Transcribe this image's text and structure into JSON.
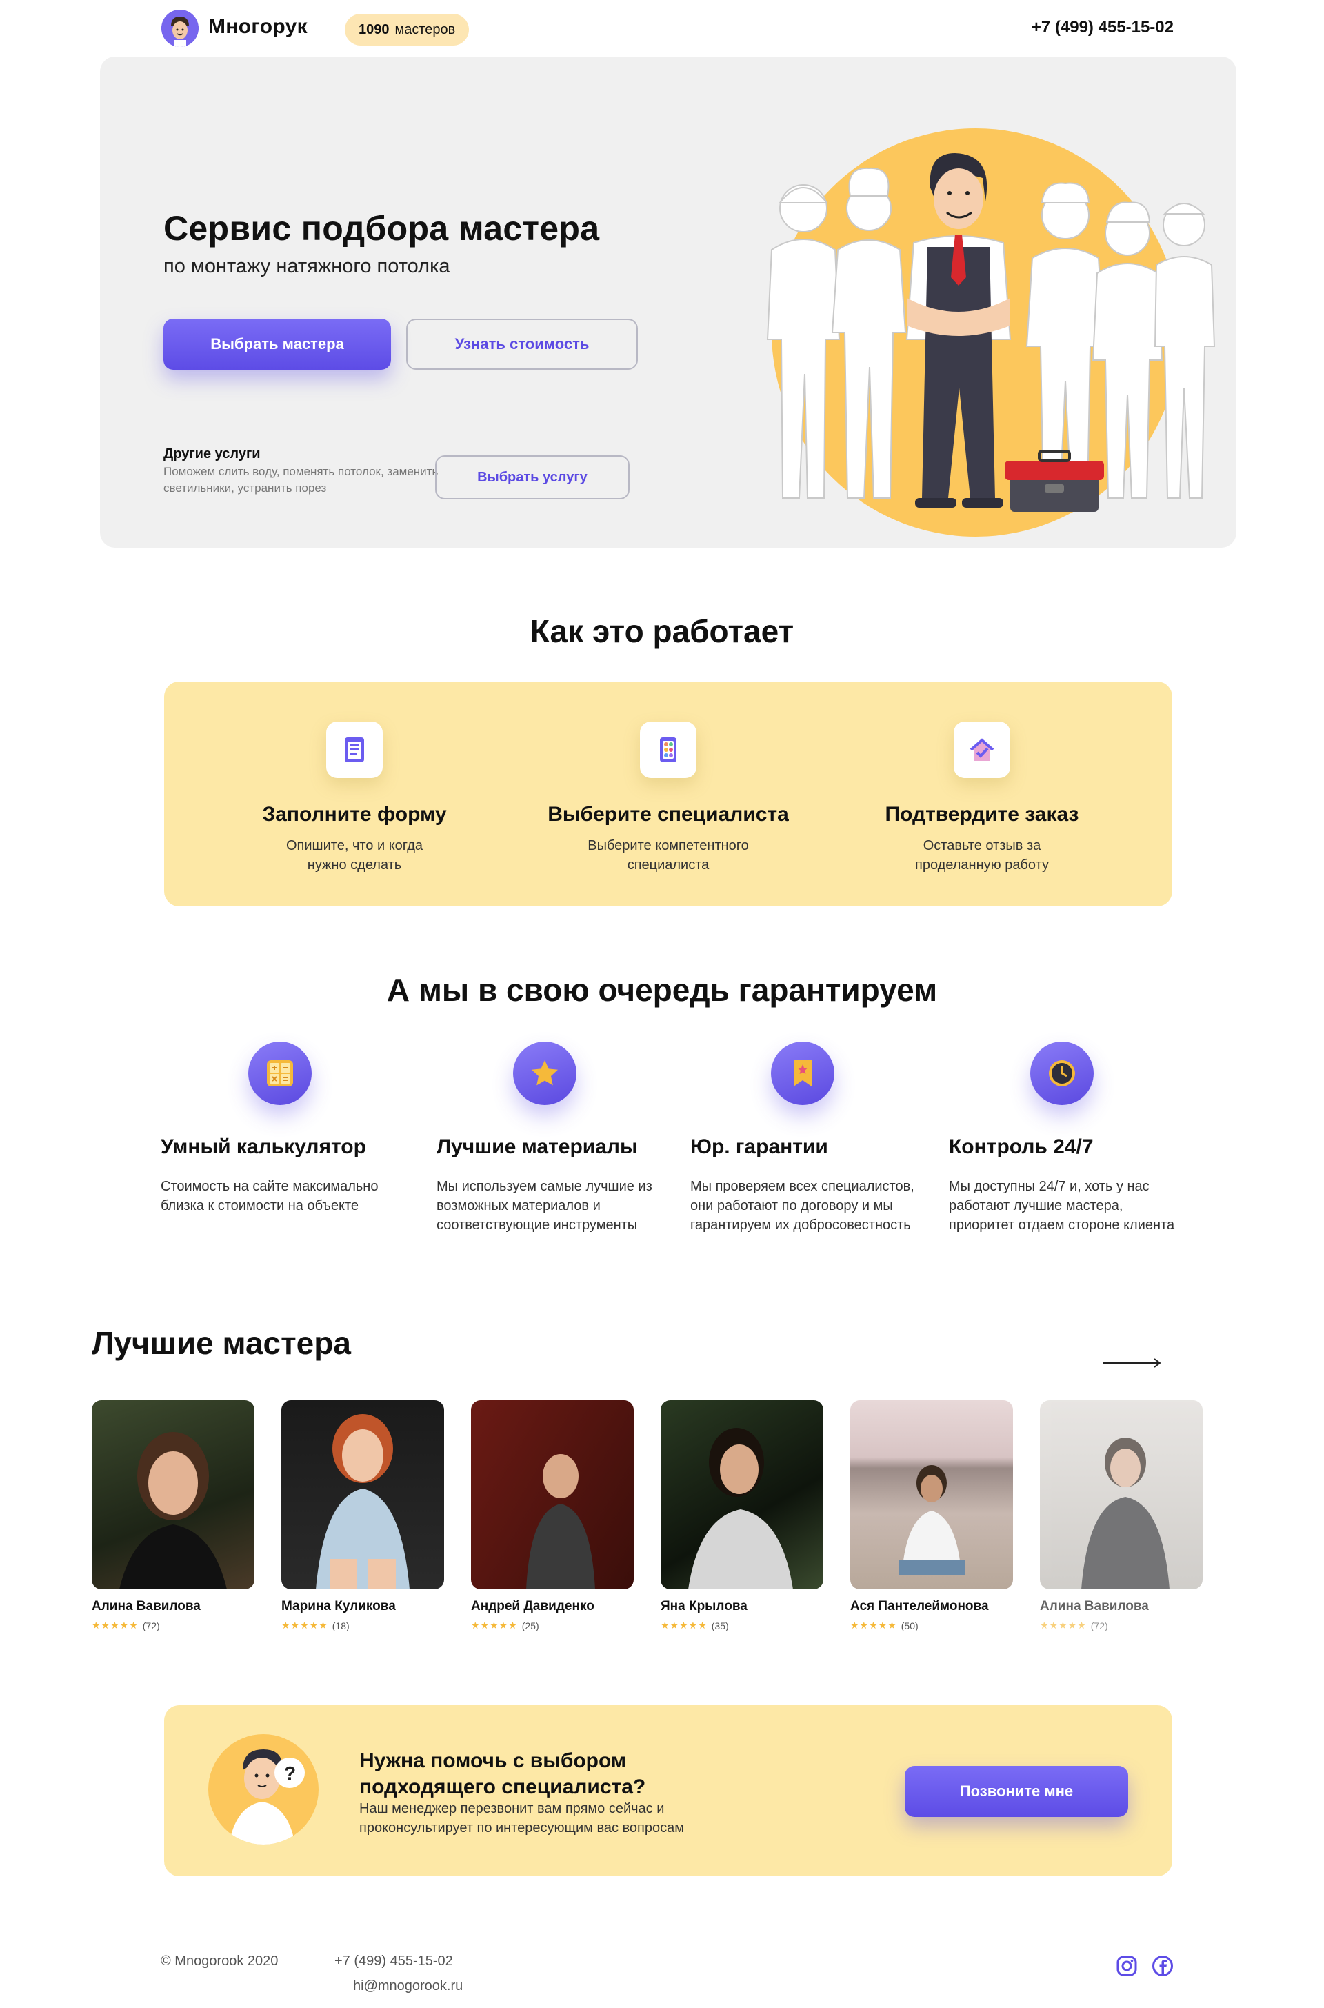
{
  "header": {
    "brand": "Многорук",
    "masters_count": "1090",
    "masters_label": "мастеров",
    "phone": "+7 (499) 455-15-02"
  },
  "hero": {
    "title": "Сервис подбора мастера",
    "subtitle": "по монтажу натяжного потолка",
    "primary_button": "Выбрать мастера",
    "secondary_button": "Узнать стоимость",
    "other_title": "Другие услуги",
    "other_desc": "Поможем слить воду, поменять потолок, заменить светильники, устранить порез",
    "other_button": "Выбрать услугу"
  },
  "how": {
    "title": "Как это работает",
    "steps": [
      {
        "icon": "form-icon",
        "title": "Заполните форму",
        "desc": "Опишите, что и когда нужно сделать"
      },
      {
        "icon": "specialist-icon",
        "title": "Выберите специалиста",
        "desc": "Выберите компетентного специалиста"
      },
      {
        "icon": "house-check-icon",
        "title": "Подтвердите заказ",
        "desc": "Оставьте отзыв за проделанную работу"
      }
    ]
  },
  "guarantee": {
    "title": "А мы в свою очередь гарантируем",
    "items": [
      {
        "icon": "calculator-icon",
        "title": "Умный калькулятор",
        "desc": "Стоимость на сайте максимально близка к стоимости на объекте"
      },
      {
        "icon": "star-icon",
        "title": "Лучшие материалы",
        "desc": "Мы используем самые лучшие из возможных материалов и соответствующие инструменты"
      },
      {
        "icon": "bookmark-icon",
        "title": "Юр. гарантии",
        "desc": "Мы проверяем всех специалистов, они работают по договору и мы гарантируем их добросовестность"
      },
      {
        "icon": "clock-icon",
        "title": "Контроль 24/7",
        "desc": "Мы доступны 24/7 и, хоть у нас работают лучшие мастера, приоритет отдаем стороне клиента"
      }
    ]
  },
  "masters": {
    "title": "Лучшие мастера",
    "arrow": "⟶",
    "list": [
      {
        "name": "Алина Вавилова",
        "reviews": "(72)",
        "rating": 5
      },
      {
        "name": "Марина Куликова",
        "reviews": "(18)",
        "rating": 5
      },
      {
        "name": "Андрей Давиденко",
        "reviews": "(25)",
        "rating": 5
      },
      {
        "name": "Яна Крылова",
        "reviews": "(35)",
        "rating": 5
      },
      {
        "name": "Ася Пантелеймонова",
        "reviews": "(50)",
        "rating": 5
      },
      {
        "name": "Алина Вавилова",
        "reviews": "(72)",
        "rating": 5
      }
    ],
    "star_glyphs": "★★★★★"
  },
  "cta": {
    "title": "Нужна помочь с выбором подходящего специалиста?",
    "desc": "Наш менеджер перезвонит вам прямо сейчас и проконсультирует по интересующим вас вопросам",
    "button": "Позвоните мне"
  },
  "footer": {
    "copyright": "© Mnogorook 2020",
    "phone": "+7 (499) 455-15-02",
    "email": "hi@mnogorook.ru"
  },
  "colors": {
    "accent": "#5d4ce6",
    "yellow_panel": "#fde8a6",
    "hero_bg": "#f0f0f0",
    "badge_bg": "#fde6b3",
    "star": "#f5b93a"
  }
}
